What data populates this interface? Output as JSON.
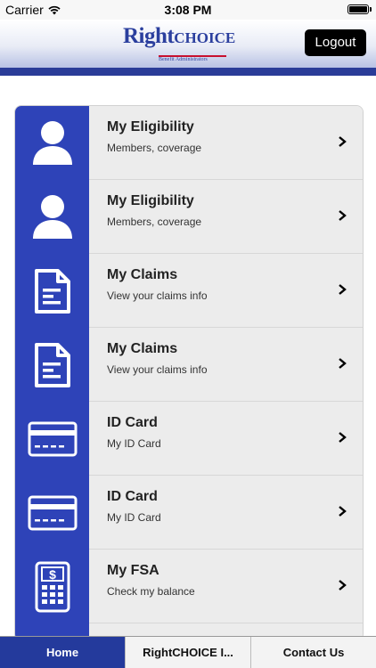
{
  "status_bar": {
    "carrier": "Carrier",
    "time": "3:08 PM",
    "wifi_icon": "wifi-icon",
    "battery_icon": "battery-icon"
  },
  "header": {
    "logo_right": "Right",
    "logo_choice": "CHOICE",
    "logo_tagline": "Benefit Administrators",
    "logout_label": "Logout",
    "accent_color": "#2a3c98"
  },
  "menu": {
    "items": [
      {
        "title": "My Eligibility",
        "subtitle": "Members, coverage",
        "icon": "person-icon"
      },
      {
        "title": "My Eligibility",
        "subtitle": "Members, coverage",
        "icon": "person-icon"
      },
      {
        "title": "My Claims",
        "subtitle": "View your claims info",
        "icon": "document-icon"
      },
      {
        "title": "My Claims",
        "subtitle": "View your claims info",
        "icon": "document-icon"
      },
      {
        "title": "ID Card",
        "subtitle": "My ID Card",
        "icon": "card-icon"
      },
      {
        "title": "ID Card",
        "subtitle": "My ID Card",
        "icon": "card-icon"
      },
      {
        "title": "My FSA",
        "subtitle": "Check my balance",
        "icon": "calculator-icon"
      },
      {
        "title": "",
        "subtitle": "",
        "icon": "document-icon"
      }
    ],
    "chevron_icon": "chevron-right-icon",
    "icon_bg_color": "#2e43b8"
  },
  "tab_bar": {
    "tabs": [
      {
        "label": "Home",
        "active": true
      },
      {
        "label": "RightCHOICE I...",
        "active": false
      },
      {
        "label": "Contact Us",
        "active": false
      }
    ],
    "active_color": "#243a9c"
  }
}
